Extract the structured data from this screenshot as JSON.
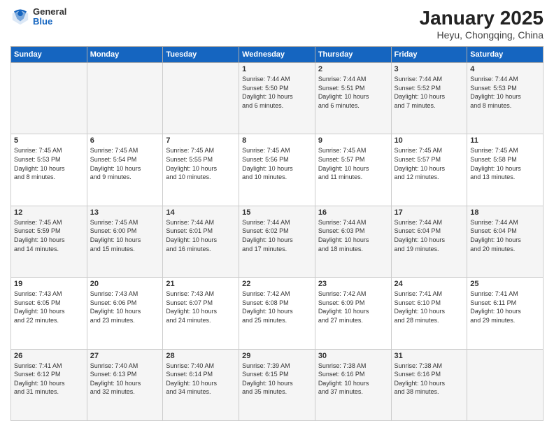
{
  "header": {
    "logo": {
      "general": "General",
      "blue": "Blue"
    },
    "title": "January 2025",
    "subtitle": "Heyu, Chongqing, China"
  },
  "days_of_week": [
    "Sunday",
    "Monday",
    "Tuesday",
    "Wednesday",
    "Thursday",
    "Friday",
    "Saturday"
  ],
  "weeks": [
    [
      {
        "day": "",
        "info": ""
      },
      {
        "day": "",
        "info": ""
      },
      {
        "day": "",
        "info": ""
      },
      {
        "day": "1",
        "info": "Sunrise: 7:44 AM\nSunset: 5:50 PM\nDaylight: 10 hours\nand 6 minutes."
      },
      {
        "day": "2",
        "info": "Sunrise: 7:44 AM\nSunset: 5:51 PM\nDaylight: 10 hours\nand 6 minutes."
      },
      {
        "day": "3",
        "info": "Sunrise: 7:44 AM\nSunset: 5:52 PM\nDaylight: 10 hours\nand 7 minutes."
      },
      {
        "day": "4",
        "info": "Sunrise: 7:44 AM\nSunset: 5:53 PM\nDaylight: 10 hours\nand 8 minutes."
      }
    ],
    [
      {
        "day": "5",
        "info": "Sunrise: 7:45 AM\nSunset: 5:53 PM\nDaylight: 10 hours\nand 8 minutes."
      },
      {
        "day": "6",
        "info": "Sunrise: 7:45 AM\nSunset: 5:54 PM\nDaylight: 10 hours\nand 9 minutes."
      },
      {
        "day": "7",
        "info": "Sunrise: 7:45 AM\nSunset: 5:55 PM\nDaylight: 10 hours\nand 10 minutes."
      },
      {
        "day": "8",
        "info": "Sunrise: 7:45 AM\nSunset: 5:56 PM\nDaylight: 10 hours\nand 10 minutes."
      },
      {
        "day": "9",
        "info": "Sunrise: 7:45 AM\nSunset: 5:57 PM\nDaylight: 10 hours\nand 11 minutes."
      },
      {
        "day": "10",
        "info": "Sunrise: 7:45 AM\nSunset: 5:57 PM\nDaylight: 10 hours\nand 12 minutes."
      },
      {
        "day": "11",
        "info": "Sunrise: 7:45 AM\nSunset: 5:58 PM\nDaylight: 10 hours\nand 13 minutes."
      }
    ],
    [
      {
        "day": "12",
        "info": "Sunrise: 7:45 AM\nSunset: 5:59 PM\nDaylight: 10 hours\nand 14 minutes."
      },
      {
        "day": "13",
        "info": "Sunrise: 7:45 AM\nSunset: 6:00 PM\nDaylight: 10 hours\nand 15 minutes."
      },
      {
        "day": "14",
        "info": "Sunrise: 7:44 AM\nSunset: 6:01 PM\nDaylight: 10 hours\nand 16 minutes."
      },
      {
        "day": "15",
        "info": "Sunrise: 7:44 AM\nSunset: 6:02 PM\nDaylight: 10 hours\nand 17 minutes."
      },
      {
        "day": "16",
        "info": "Sunrise: 7:44 AM\nSunset: 6:03 PM\nDaylight: 10 hours\nand 18 minutes."
      },
      {
        "day": "17",
        "info": "Sunrise: 7:44 AM\nSunset: 6:04 PM\nDaylight: 10 hours\nand 19 minutes."
      },
      {
        "day": "18",
        "info": "Sunrise: 7:44 AM\nSunset: 6:04 PM\nDaylight: 10 hours\nand 20 minutes."
      }
    ],
    [
      {
        "day": "19",
        "info": "Sunrise: 7:43 AM\nSunset: 6:05 PM\nDaylight: 10 hours\nand 22 minutes."
      },
      {
        "day": "20",
        "info": "Sunrise: 7:43 AM\nSunset: 6:06 PM\nDaylight: 10 hours\nand 23 minutes."
      },
      {
        "day": "21",
        "info": "Sunrise: 7:43 AM\nSunset: 6:07 PM\nDaylight: 10 hours\nand 24 minutes."
      },
      {
        "day": "22",
        "info": "Sunrise: 7:42 AM\nSunset: 6:08 PM\nDaylight: 10 hours\nand 25 minutes."
      },
      {
        "day": "23",
        "info": "Sunrise: 7:42 AM\nSunset: 6:09 PM\nDaylight: 10 hours\nand 27 minutes."
      },
      {
        "day": "24",
        "info": "Sunrise: 7:41 AM\nSunset: 6:10 PM\nDaylight: 10 hours\nand 28 minutes."
      },
      {
        "day": "25",
        "info": "Sunrise: 7:41 AM\nSunset: 6:11 PM\nDaylight: 10 hours\nand 29 minutes."
      }
    ],
    [
      {
        "day": "26",
        "info": "Sunrise: 7:41 AM\nSunset: 6:12 PM\nDaylight: 10 hours\nand 31 minutes."
      },
      {
        "day": "27",
        "info": "Sunrise: 7:40 AM\nSunset: 6:13 PM\nDaylight: 10 hours\nand 32 minutes."
      },
      {
        "day": "28",
        "info": "Sunrise: 7:40 AM\nSunset: 6:14 PM\nDaylight: 10 hours\nand 34 minutes."
      },
      {
        "day": "29",
        "info": "Sunrise: 7:39 AM\nSunset: 6:15 PM\nDaylight: 10 hours\nand 35 minutes."
      },
      {
        "day": "30",
        "info": "Sunrise: 7:38 AM\nSunset: 6:16 PM\nDaylight: 10 hours\nand 37 minutes."
      },
      {
        "day": "31",
        "info": "Sunrise: 7:38 AM\nSunset: 6:16 PM\nDaylight: 10 hours\nand 38 minutes."
      },
      {
        "day": "",
        "info": ""
      }
    ]
  ]
}
